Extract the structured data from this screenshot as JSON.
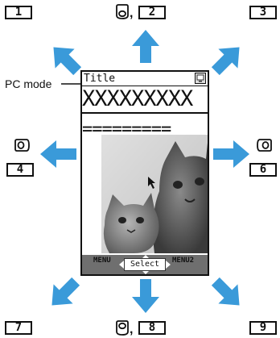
{
  "keys": {
    "k1": "1",
    "k2": "2",
    "k3": "3",
    "k4": "4",
    "k6": "6",
    "k7": "7",
    "k8": "8",
    "k9": "9"
  },
  "comma": ",",
  "pc_mode_label": "PC mode",
  "screen": {
    "title": "Title",
    "x_row": "XXXXXXXXX",
    "eq_row": "=========",
    "soft_left": "MENU",
    "soft_center": "Select",
    "soft_right": "MENU2"
  },
  "colors": {
    "arrow": "#3a9ad9",
    "key_border": "#111111",
    "soft_bar": "#6f6f6f"
  },
  "icons": {
    "top_left_side": "nav-key-up-icon",
    "bottom_side": "nav-key-down-icon",
    "left_side": "nav-key-left-icon",
    "right_side": "nav-key-right-icon"
  }
}
